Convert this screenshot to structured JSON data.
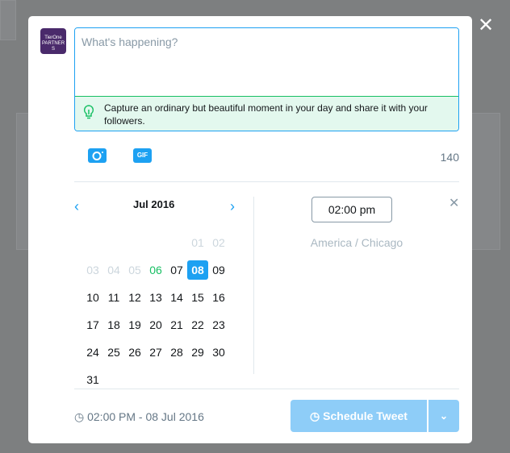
{
  "avatar": {
    "text": "TierOne PARTNERS"
  },
  "compose": {
    "placeholder": "What's happening?",
    "tip": "Capture an ordinary but beautiful moment in your day and share it with your followers.",
    "char_count": "140"
  },
  "media": {
    "gif_label": "GIF"
  },
  "calendar": {
    "month": "Jul 2016",
    "days": [
      {
        "d": "01",
        "s": "out"
      },
      {
        "d": "02",
        "s": "out"
      },
      {
        "d": "03",
        "s": "out"
      },
      {
        "d": "04",
        "s": "out"
      },
      {
        "d": "05",
        "s": "out"
      },
      {
        "d": "06",
        "s": "today"
      },
      {
        "d": "07",
        "s": ""
      },
      {
        "d": "08",
        "s": "sel"
      },
      {
        "d": "09",
        "s": ""
      },
      {
        "d": "10",
        "s": ""
      },
      {
        "d": "11",
        "s": ""
      },
      {
        "d": "12",
        "s": ""
      },
      {
        "d": "13",
        "s": ""
      },
      {
        "d": "14",
        "s": ""
      },
      {
        "d": "15",
        "s": ""
      },
      {
        "d": "16",
        "s": ""
      },
      {
        "d": "17",
        "s": ""
      },
      {
        "d": "18",
        "s": ""
      },
      {
        "d": "19",
        "s": ""
      },
      {
        "d": "20",
        "s": ""
      },
      {
        "d": "21",
        "s": ""
      },
      {
        "d": "22",
        "s": ""
      },
      {
        "d": "23",
        "s": ""
      },
      {
        "d": "24",
        "s": ""
      },
      {
        "d": "25",
        "s": ""
      },
      {
        "d": "26",
        "s": ""
      },
      {
        "d": "27",
        "s": ""
      },
      {
        "d": "28",
        "s": ""
      },
      {
        "d": "29",
        "s": ""
      },
      {
        "d": "30",
        "s": ""
      },
      {
        "d": "31",
        "s": ""
      }
    ],
    "first_weekday": 5
  },
  "time": {
    "value": "02:00 pm",
    "timezone": "America / Chicago"
  },
  "footer": {
    "scheduled": "02:00 PM - 08 Jul 2016",
    "button": "Schedule Tweet"
  },
  "colors": {
    "accent": "#1da1f2",
    "success": "#17bf63",
    "button_disabled": "#8ecdf8"
  }
}
